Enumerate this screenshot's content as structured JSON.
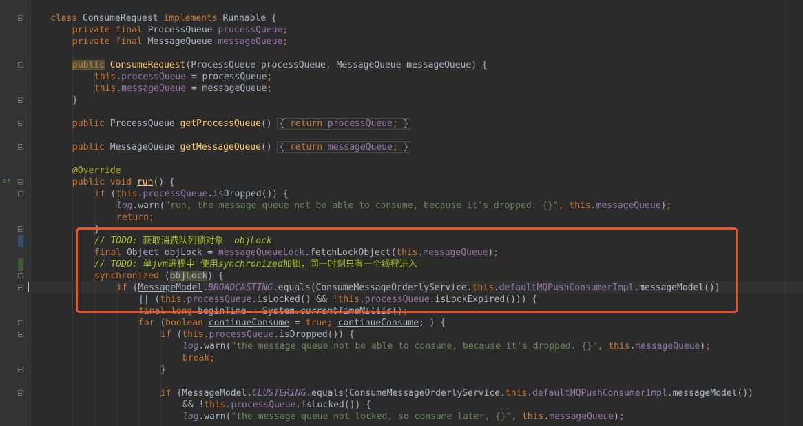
{
  "colors": {
    "background": "#2b2b2b",
    "keyword": "#cc7832",
    "field": "#9876aa",
    "method": "#ffc66d",
    "string": "#6a8759",
    "annotation": "#bbb529",
    "todo_comment": "#a8c023",
    "highlight_box": "#e8542a"
  },
  "icons": {
    "override_marker": "override-up-arrow-icon",
    "fold_marker": "fold-minus-icon"
  },
  "code": {
    "l1": {
      "t1": "class ",
      "t2": "ConsumeRequest ",
      "t3": "implements ",
      "t4": "Runnable {"
    },
    "l2": {
      "t1": "private final ",
      "t2": "ProcessQueue ",
      "t3": "processQueue",
      "t4": ";"
    },
    "l3": {
      "t1": "private final ",
      "t2": "MessageQueue ",
      "t3": "messageQueue",
      "t4": ";"
    },
    "l4": {
      "t1": "public",
      "t2": " ",
      "t3": "ConsumeRequest",
      "t4": "(ProcessQueue processQueue",
      "t5": ", ",
      "t6": "MessageQueue messageQueue) {"
    },
    "l5": {
      "t1": "this",
      "t2": ".",
      "t3": "processQueue",
      "t4": " = processQueue",
      "t5": ";"
    },
    "l6": {
      "t1": "this",
      "t2": ".",
      "t3": "messageQueue",
      "t4": " = messageQueue",
      "t5": ";"
    },
    "l7": {
      "t1": "}"
    },
    "l8": {
      "t1": "public ",
      "t2": "ProcessQueue ",
      "t3": "getProcessQueue",
      "t4": "() ",
      "t5": "{ ",
      "t6": "return ",
      "t7": "processQueue",
      "t8": "; ",
      "t9": "}"
    },
    "l9": {
      "t1": "public ",
      "t2": "MessageQueue ",
      "t3": "getMessageQueue",
      "t4": "() ",
      "t5": "{ ",
      "t6": "return ",
      "t7": "messageQueue",
      "t8": "; ",
      "t9": "}"
    },
    "l10": {
      "t1": "@Override"
    },
    "l11": {
      "t1": "public void ",
      "t2": "run",
      "t3": "() {"
    },
    "l12": {
      "t1": "if ",
      "t2": "(",
      "t3": "this",
      "t4": ".",
      "t5": "processQueue",
      "t6": ".isDropped()) {"
    },
    "l13": {
      "t1": "log",
      "t2": ".warn(",
      "t3": "\"run, the message queue not be able to consume, because it's dropped. {}\"",
      "t4": ", ",
      "t5": "this",
      "t6": ".",
      "t7": "messageQueue",
      "t8": ")",
      "t9": ";"
    },
    "l14": {
      "t1": "return",
      "t2": ";"
    },
    "l15": {
      "t1": "}"
    },
    "l16": {
      "t1": "// TODO: ",
      "t2": "获取消费队列锁对象  ",
      "t3": "objLock"
    },
    "l17": {
      "t1": "final ",
      "t2": "Object objLock = ",
      "t3": "messageQueueLock",
      "t4": ".fetchLockObject(",
      "t5": "this",
      "t6": ".",
      "t7": "messageQueue",
      "t8": ")",
      "t9": ";"
    },
    "l18": {
      "t1": "// TODO: ",
      "t2": "单",
      "t3": "jvm",
      "t4": "进程中 使用",
      "t5": "synchronized",
      "t6": "加锁，同一时刻只有一个线程进入"
    },
    "l19": {
      "t1": "synchronized ",
      "t2": "(",
      "t3": "objLock",
      "t4": ") {"
    },
    "l20": {
      "t1": "if ",
      "t2": "(",
      "t3": "MessageModel",
      "t4": ".",
      "t5": "BROADCASTING",
      "t6": ".equals(ConsumeMessageOrderlyService.",
      "t7": "this",
      "t8": ".",
      "t9": "defaultMQPushConsumerImpl",
      "t10": ".messageModel())"
    },
    "l21": {
      "t1": "|| (",
      "t2": "this",
      "t3": ".",
      "t4": "processQueue",
      "t5": ".isLocked() && !",
      "t6": "this",
      "t7": ".",
      "t8": "processQueue",
      "t9": ".isLockExpired())) {"
    },
    "l22": {
      "t1": "final long ",
      "t2": "beginTime = System.",
      "t3": "currentTimeMillis",
      "t4": "()",
      "t5": ";"
    },
    "l23": {
      "t1": "for ",
      "t2": "(",
      "t3": "boolean ",
      "t4": "continueConsume",
      "t5": " = ",
      "t6": "true",
      "t7": "; ",
      "t8": "continueConsume",
      "t9": "; ) {"
    },
    "l24": {
      "t1": "if ",
      "t2": "(",
      "t3": "this",
      "t4": ".",
      "t5": "processQueue",
      "t6": ".isDropped()) {"
    },
    "l25": {
      "t1": "log",
      "t2": ".warn(",
      "t3": "\"the message queue not be able to consume, because it's dropped. {}\"",
      "t4": ", ",
      "t5": "this",
      "t6": ".",
      "t7": "messageQueue",
      "t8": ")",
      "t9": ";"
    },
    "l26": {
      "t1": "break",
      "t2": ";"
    },
    "l27": {
      "t1": "}"
    },
    "l28": {
      "t1": "if ",
      "t2": "(MessageModel.",
      "t3": "CLUSTERING",
      "t4": ".equals(ConsumeMessageOrderlyService.",
      "t5": "this",
      "t6": ".",
      "t7": "defaultMQPushConsumerImpl",
      "t8": ".messageModel())"
    },
    "l29": {
      "t1": "&& !",
      "t2": "this",
      "t3": ".",
      "t4": "processQueue",
      "t5": ".isLocked()) {"
    },
    "l30": {
      "t1": "log",
      "t2": ".warn(",
      "t3": "\"the message queue not locked, so consume later, {}\"",
      "t4": ", ",
      "t5": "this",
      "t6": ".",
      "t7": "messageQueue",
      "t8": ")",
      "t9": ";"
    }
  }
}
